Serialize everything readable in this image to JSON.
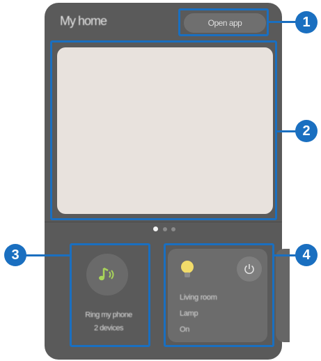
{
  "header": {
    "title": "My home",
    "open_app_label": "Open app"
  },
  "carousel": {
    "page_count": 3,
    "active_page": 1
  },
  "ring_tile": {
    "icon": "music-note-icon",
    "line1": "Ring my phone",
    "line2": "2 devices"
  },
  "device_card": {
    "icon": "light-bulb-icon",
    "power_icon": "power-icon",
    "room": "Living room",
    "name": "Lamp",
    "status": "On"
  },
  "callouts": [
    "1",
    "2",
    "3",
    "4"
  ],
  "colors": {
    "callout_blue": "#1a6fc0",
    "panel": "#5a5a5a",
    "card": "#e8e2dd",
    "music_green": "#a8d35a",
    "bulb_yellow": "#f2dc6a"
  }
}
